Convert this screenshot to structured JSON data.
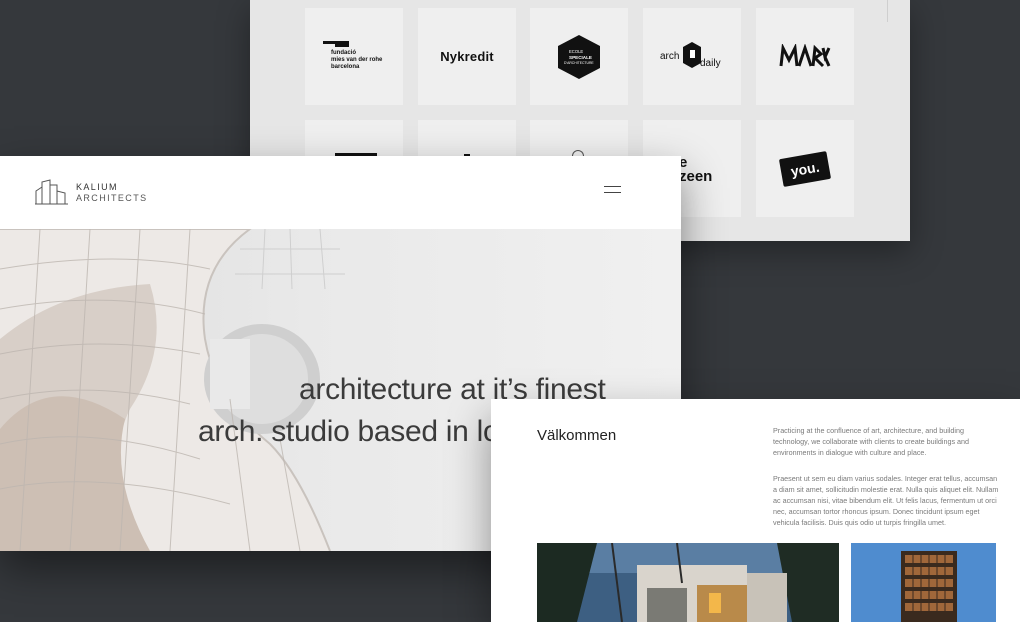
{
  "logo_panel": {
    "tiles": [
      {
        "name": "fundacio-mies-van-der-rohe",
        "lines": [
          "fundació",
          "mies van der rohe",
          "barcelona"
        ]
      },
      {
        "name": "nykredit",
        "text": "Nykredit"
      },
      {
        "name": "ecole-speciale-architecture",
        "lines": [
          "ECOLE",
          "SPECIALE",
          "D'ARCHITECTURE"
        ]
      },
      {
        "name": "archdaily",
        "left": "arch",
        "right": "daily"
      },
      {
        "name": "mark",
        "text": "MARK"
      },
      {
        "name": "partial-logo-1"
      },
      {
        "name": "partial-logo-2"
      },
      {
        "name": "partial-logo-3"
      },
      {
        "name": "dezeen",
        "text": "zeen",
        "top": "e"
      },
      {
        "name": "you",
        "text": "you."
      }
    ]
  },
  "hero": {
    "brand": {
      "name": "KALIUM",
      "sub": "ARCHITECTS"
    },
    "menu_icon": "hamburger-icon",
    "headline_1": "architecture at it’s finest",
    "headline_2": "arch. studio based in lo"
  },
  "welcome": {
    "title": "Välkommen",
    "para_1": "Practicing at the confluence of art, architecture, and building technology, we collaborate with clients to create buildings and environments in dialogue with culture and place.",
    "para_2": "Praesent ut sem eu diam varius sodales. Integer erat tellus, accumsan a diam sit amet, sollicitudin molestie erat. Nulla quis aliquet elit. Nullam ac accumsan nisi, vitae bibendum elit. Ut felis lacus, fermentum ut orci nec, accumsan tortor rhoncus ipsum. Donec tincidunt ipsum eget vehicula facilisis. Duis quis odio ut turpis fringilla umet."
  },
  "colors": {
    "background": "#35383c",
    "panel": "#e6e6e6",
    "tile": "#efefef",
    "text": "#3b3b3b",
    "muted": "#7a7a7a"
  }
}
